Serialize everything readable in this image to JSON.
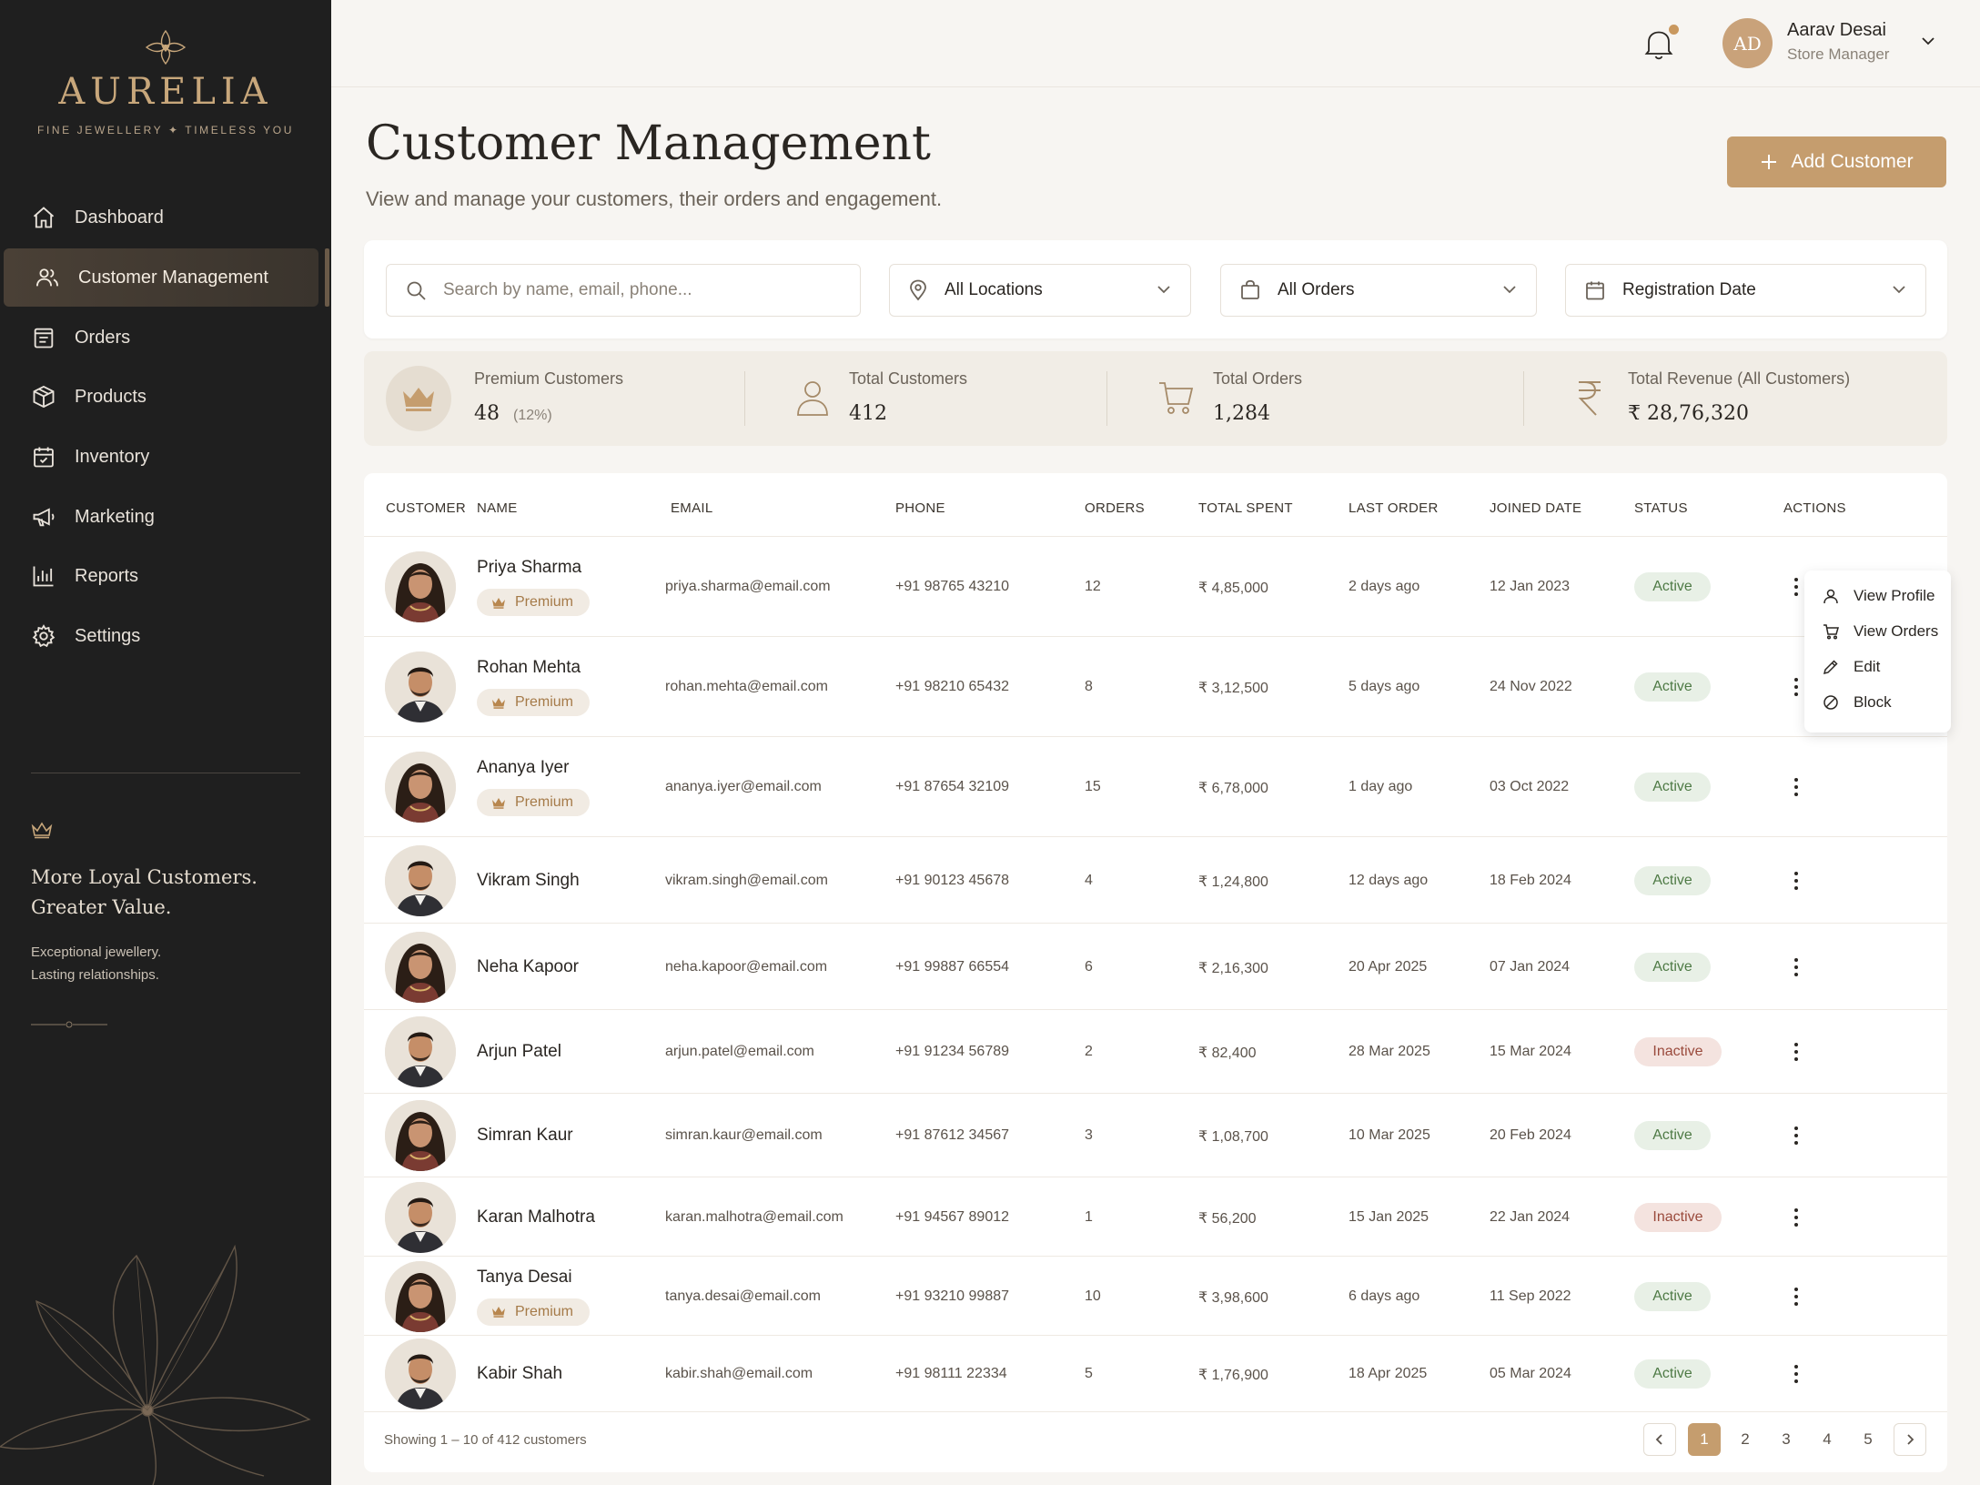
{
  "brand": {
    "name": "AURELIA",
    "tagline": "FINE JEWELLERY ✦ TIMELESS YOU"
  },
  "nav": [
    {
      "label": "Dashboard",
      "icon": "home-icon",
      "active": false
    },
    {
      "label": "Customer Management",
      "icon": "users-icon",
      "active": true
    },
    {
      "label": "Orders",
      "icon": "orders-icon",
      "active": false
    },
    {
      "label": "Products",
      "icon": "box-icon",
      "active": false
    },
    {
      "label": "Inventory",
      "icon": "inventory-icon",
      "active": false
    },
    {
      "label": "Marketing",
      "icon": "megaphone-icon",
      "active": false
    },
    {
      "label": "Reports",
      "icon": "bar-chart-icon",
      "active": false
    },
    {
      "label": "Settings",
      "icon": "gear-icon",
      "active": false
    }
  ],
  "promo": {
    "title_line1": "More Loyal Customers.",
    "title_line2": "Greater Value.",
    "sub_line1": "Exceptional jewellery.",
    "sub_line2": "Lasting relationships."
  },
  "user": {
    "initials": "AD",
    "name": "Aarav Desai",
    "role": "Store Manager"
  },
  "header": {
    "title": "Customer Management",
    "subtitle": "View and manage your customers, their orders and engagement.",
    "add_button": "Add Customer"
  },
  "filters": {
    "search_placeholder": "Search by name, email, phone...",
    "location": "All Locations",
    "orders": "All Orders",
    "date": "Registration Date"
  },
  "stats": {
    "premium": {
      "label": "Premium Customers",
      "value": "48",
      "percent": "(12%)"
    },
    "total_customers": {
      "label": "Total Customers",
      "value": "412"
    },
    "total_orders": {
      "label": "Total Orders",
      "value": "1,284"
    },
    "revenue": {
      "label": "Total Revenue (All Customers)",
      "value": "₹ 28,76,320"
    }
  },
  "table": {
    "columns": [
      "CUSTOMER",
      "NAME",
      "EMAIL",
      "PHONE",
      "ORDERS",
      "TOTAL SPENT",
      "LAST ORDER",
      "JOINED DATE",
      "STATUS",
      "ACTIONS"
    ],
    "premium_label": "Premium",
    "rows": [
      {
        "name": "Priya Sharma",
        "premium": true,
        "gender": "f",
        "email": "priya.sharma@email.com",
        "phone": "+91 98765 43210",
        "orders": "12",
        "spent": "₹ 4,85,000",
        "last_order": "2 days ago",
        "joined": "12 Jan 2023",
        "status": "Active"
      },
      {
        "name": "Rohan Mehta",
        "premium": true,
        "gender": "m",
        "email": "rohan.mehta@email.com",
        "phone": "+91 98210 65432",
        "orders": "8",
        "spent": "₹ 3,12,500",
        "last_order": "5 days ago",
        "joined": "24 Nov 2022",
        "status": "Active"
      },
      {
        "name": "Ananya Iyer",
        "premium": true,
        "gender": "f",
        "email": "ananya.iyer@email.com",
        "phone": "+91 87654 32109",
        "orders": "15",
        "spent": "₹ 6,78,000",
        "last_order": "1 day ago",
        "joined": "03 Oct 2022",
        "status": "Active"
      },
      {
        "name": "Vikram Singh",
        "premium": false,
        "gender": "m",
        "email": "vikram.singh@email.com",
        "phone": "+91 90123 45678",
        "orders": "4",
        "spent": "₹ 1,24,800",
        "last_order": "12 days ago",
        "joined": "18 Feb 2024",
        "status": "Active"
      },
      {
        "name": "Neha Kapoor",
        "premium": false,
        "gender": "f",
        "email": "neha.kapoor@email.com",
        "phone": "+91 99887 66554",
        "orders": "6",
        "spent": "₹ 2,16,300",
        "last_order": "20 Apr 2025",
        "joined": "07 Jan 2024",
        "status": "Active"
      },
      {
        "name": "Arjun Patel",
        "premium": false,
        "gender": "m",
        "email": "arjun.patel@email.com",
        "phone": "+91 91234 56789",
        "orders": "2",
        "spent": "₹ 82,400",
        "last_order": "28 Mar 2025",
        "joined": "15 Mar 2024",
        "status": "Inactive"
      },
      {
        "name": "Simran Kaur",
        "premium": false,
        "gender": "f",
        "email": "simran.kaur@email.com",
        "phone": "+91 87612 34567",
        "orders": "3",
        "spent": "₹ 1,08,700",
        "last_order": "10 Mar 2025",
        "joined": "20 Feb 2024",
        "status": "Active"
      },
      {
        "name": "Karan Malhotra",
        "premium": false,
        "gender": "m",
        "email": "karan.malhotra@email.com",
        "phone": "+91 94567 89012",
        "orders": "1",
        "spent": "₹ 56,200",
        "last_order": "15 Jan 2025",
        "joined": "22 Jan 2024",
        "status": "Inactive"
      },
      {
        "name": "Tanya Desai",
        "premium": true,
        "gender": "f",
        "email": "tanya.desai@email.com",
        "phone": "+91 93210 99887",
        "orders": "10",
        "spent": "₹ 3,98,600",
        "last_order": "6 days ago",
        "joined": "11 Sep 2022",
        "status": "Active"
      },
      {
        "name": "Kabir Shah",
        "premium": false,
        "gender": "m",
        "email": "kabir.shah@email.com",
        "phone": "+91 98111 22334",
        "orders": "5",
        "spent": "₹ 1,76,900",
        "last_order": "18 Apr 2025",
        "joined": "05 Mar 2024",
        "status": "Active"
      }
    ]
  },
  "row_menu": {
    "items": [
      "View Profile",
      "View Orders",
      "Edit",
      "Block"
    ]
  },
  "pagination": {
    "showing": "Showing 1 – 10 of 412 customers",
    "pages": [
      "1",
      "2",
      "3",
      "4",
      "5"
    ],
    "current": "1"
  },
  "colors": {
    "accent": "#c59d6e",
    "sidebar": "#1f1f1f",
    "active_status": "#4e7a45",
    "inactive_status": "#9a4a3c"
  }
}
